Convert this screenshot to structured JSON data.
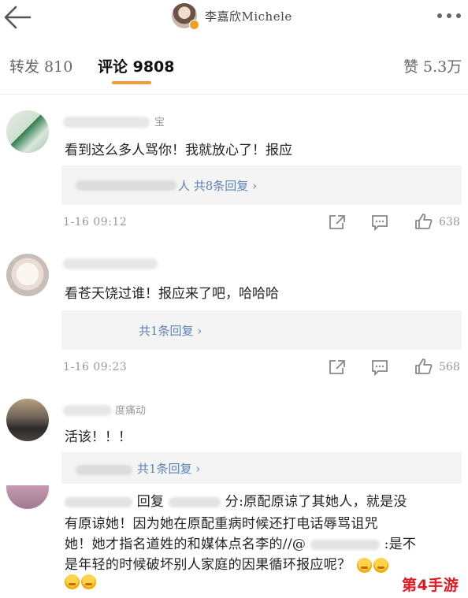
{
  "header": {
    "title": "李嘉欣Michele"
  },
  "tabs": {
    "repost": "转发 810",
    "comments": "评论 9808",
    "likes": "赞 5.3万"
  },
  "comments": [
    {
      "name_fragment": "宝",
      "text": "看到这么多人骂你！我就放心了！报应",
      "reply_summary": "人 共8条回复 ›",
      "time": "1-16 09:12",
      "likes": "638"
    },
    {
      "text": "看苍天饶过谁！报应来了吧，哈哈哈",
      "reply_summary": "共1条回复 ›",
      "time": "1-16 09:23",
      "likes": "568"
    },
    {
      "name_fragment": "度痛动",
      "text": "活该！！！",
      "reply_summary": "共1条回复 ›"
    }
  ],
  "long_reply": {
    "line1_a": "回复",
    "line1_b": "分:原配原谅了其她人，就是没",
    "line2": "有原谅她！因为她在原配重病时候还打电话辱骂诅咒",
    "line3_a": "她！她才指名道姓的和媒体点名李的//@",
    "line3_b": ":是不",
    "line4": "是年轻的时候破坏别人家庭的因果循环报应呢？"
  },
  "watermark": "第4手游"
}
